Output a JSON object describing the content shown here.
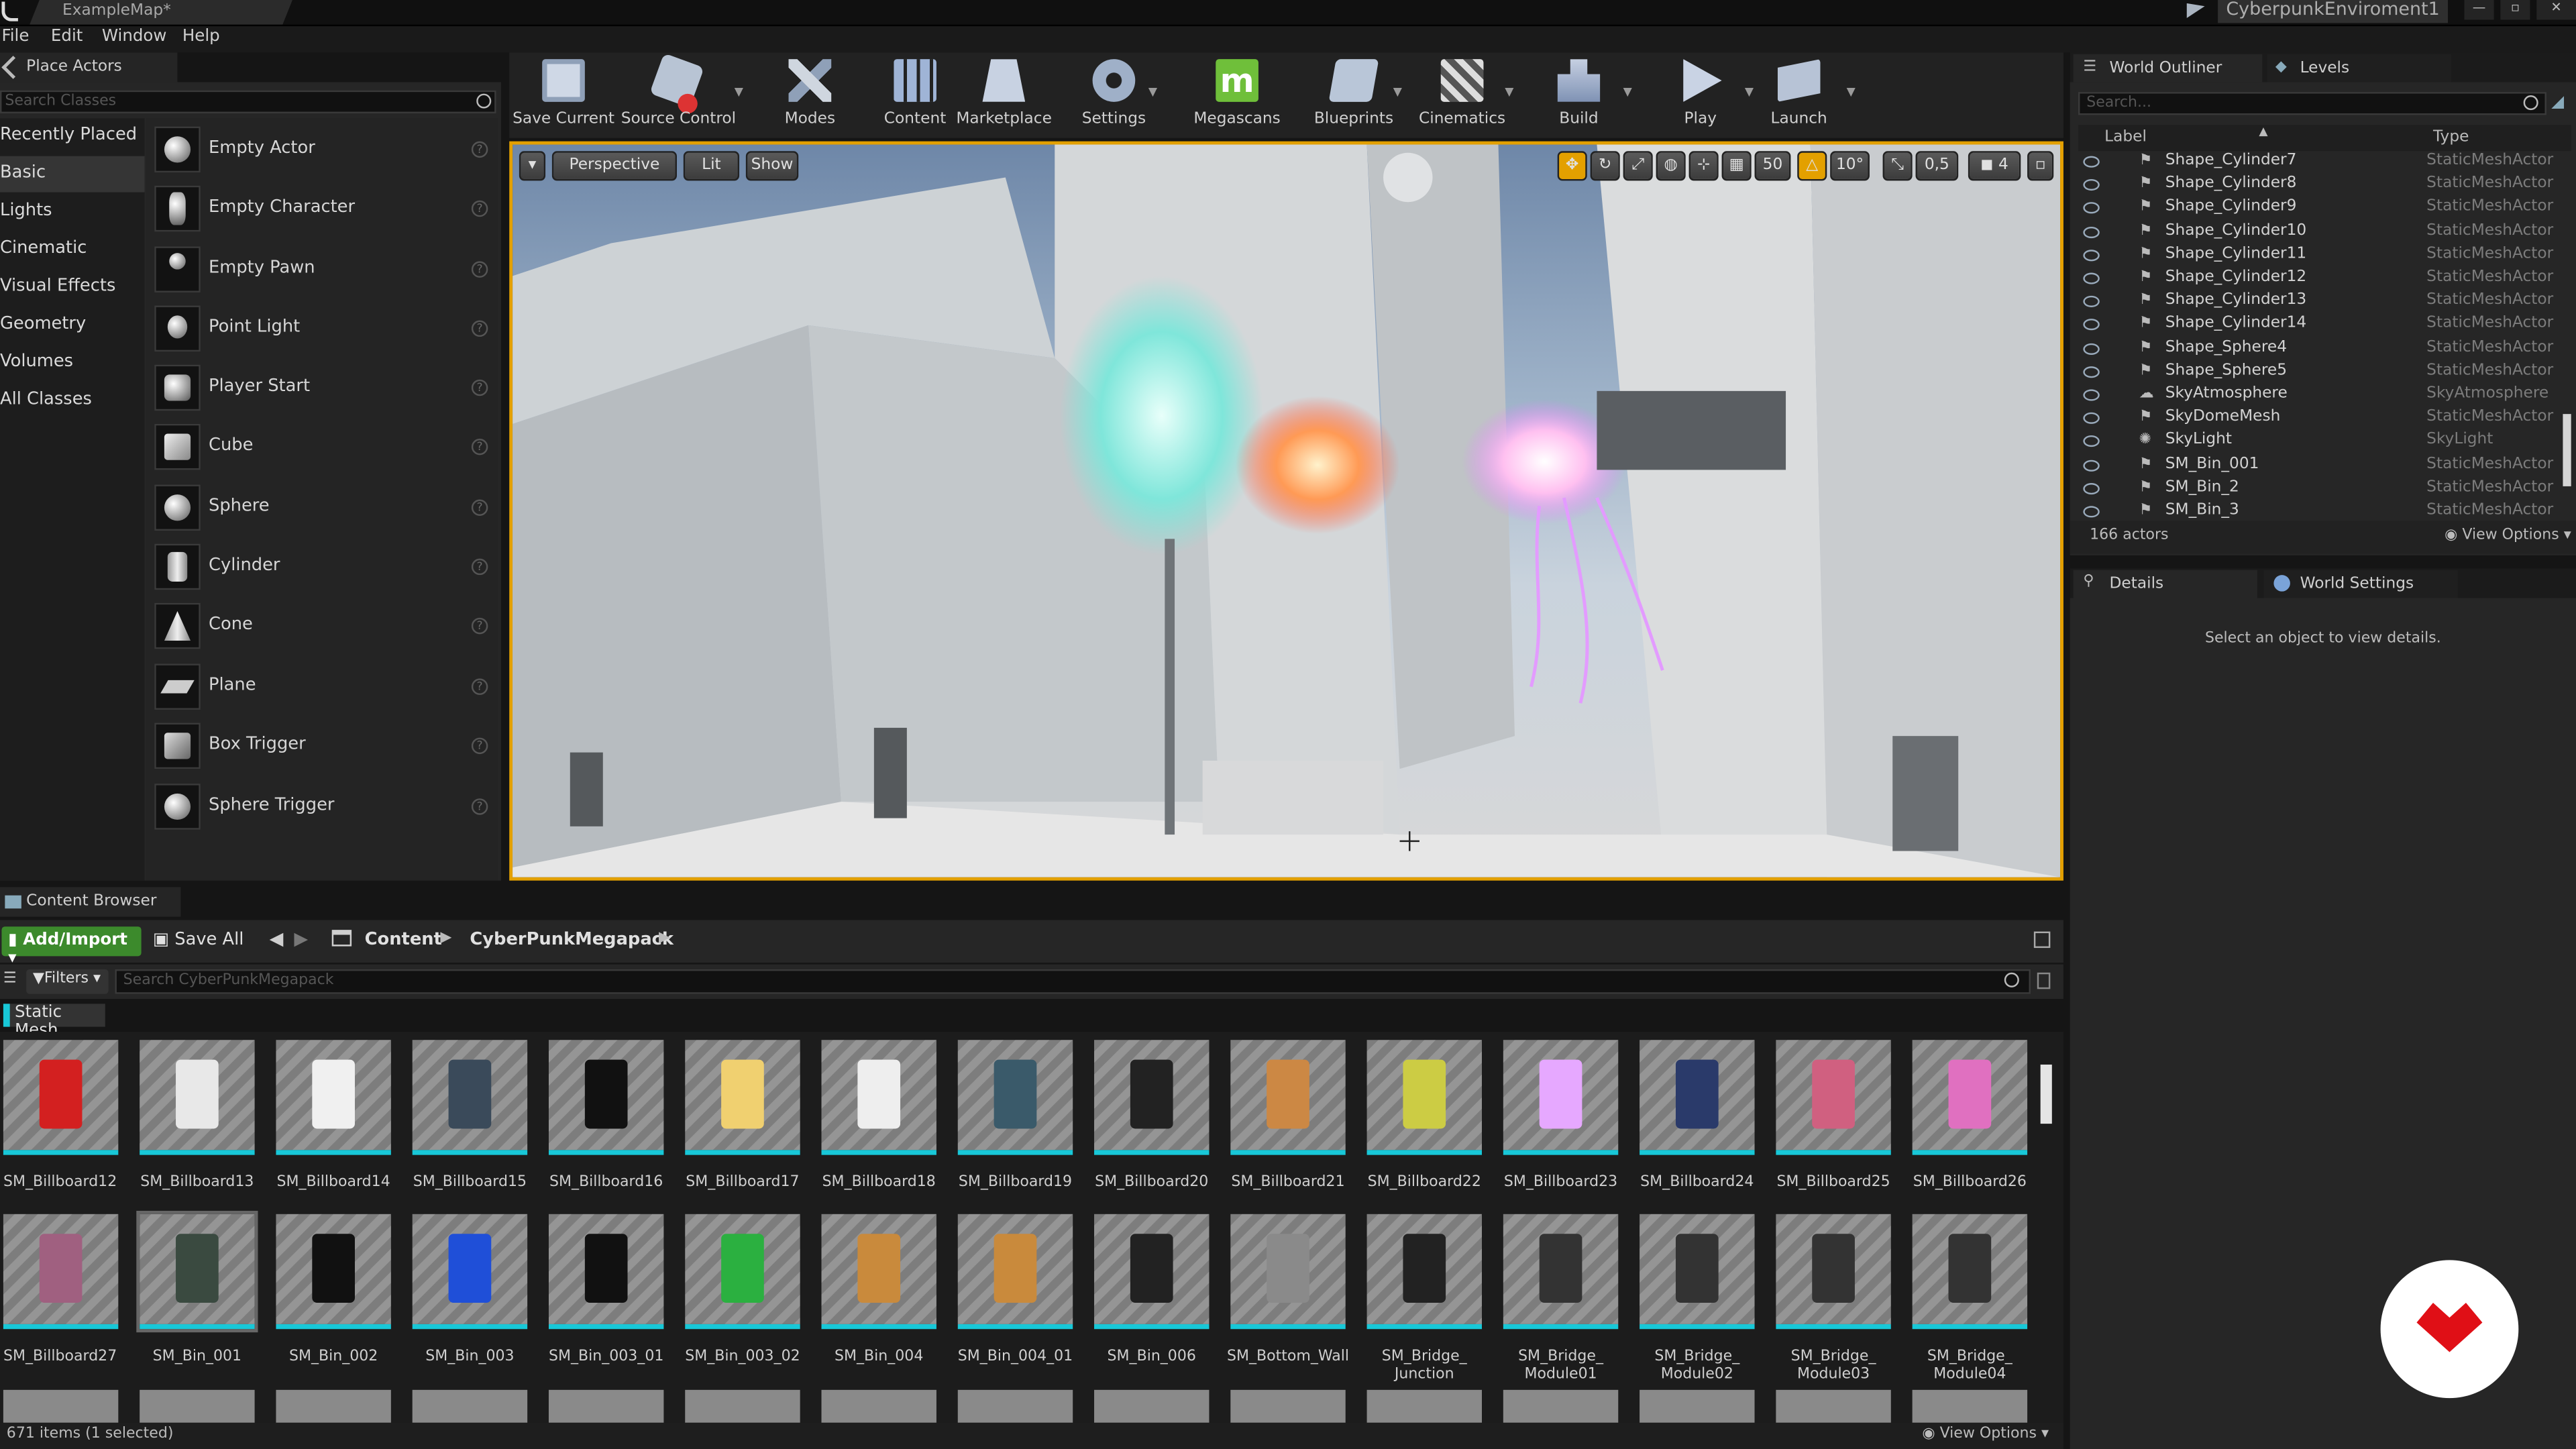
{
  "title_bar": {
    "map_tab": "ExampleMap*",
    "project_name": "CyberpunkEnviroment1"
  },
  "menu": [
    "File",
    "Edit",
    "Window",
    "Help"
  ],
  "place_actors": {
    "tab": "Place Actors",
    "search_placeholder": "Search Classes",
    "categories": [
      "Recently Placed",
      "Basic",
      "Lights",
      "Cinematic",
      "Visual Effects",
      "Geometry",
      "Volumes",
      "All Classes"
    ],
    "items": [
      "Empty Actor",
      "Empty Character",
      "Empty Pawn",
      "Point Light",
      "Player Start",
      "Cube",
      "Sphere",
      "Cylinder",
      "Cone",
      "Plane",
      "Box Trigger",
      "Sphere Trigger"
    ]
  },
  "toolbar": [
    "Save Current",
    "Source Control",
    "Modes",
    "Content",
    "Marketplace",
    "Settings",
    "Megascans",
    "Blueprints",
    "Cinematics",
    "Build",
    "Play",
    "Launch"
  ],
  "viewport": {
    "perspective": "Perspective",
    "lit": "Lit",
    "show": "Show",
    "grid": "50",
    "angle": "10°",
    "scale": "0,5",
    "speed": "4"
  },
  "outliner": {
    "tabs": [
      "World Outliner",
      "Levels"
    ],
    "search_placeholder": "Search...",
    "col_label": "Label",
    "col_type": "Type",
    "rows": [
      {
        "name": "Shape_Cylinder7",
        "type": "StaticMeshActor"
      },
      {
        "name": "Shape_Cylinder8",
        "type": "StaticMeshActor"
      },
      {
        "name": "Shape_Cylinder9",
        "type": "StaticMeshActor"
      },
      {
        "name": "Shape_Cylinder10",
        "type": "StaticMeshActor"
      },
      {
        "name": "Shape_Cylinder11",
        "type": "StaticMeshActor"
      },
      {
        "name": "Shape_Cylinder12",
        "type": "StaticMeshActor"
      },
      {
        "name": "Shape_Cylinder13",
        "type": "StaticMeshActor"
      },
      {
        "name": "Shape_Cylinder14",
        "type": "StaticMeshActor"
      },
      {
        "name": "Shape_Sphere4",
        "type": "StaticMeshActor"
      },
      {
        "name": "Shape_Sphere5",
        "type": "StaticMeshActor"
      },
      {
        "name": "SkyAtmosphere",
        "type": "SkyAtmosphere"
      },
      {
        "name": "SkyDomeMesh",
        "type": "StaticMeshActor"
      },
      {
        "name": "SkyLight",
        "type": "SkyLight"
      },
      {
        "name": "SM_Bin_001",
        "type": "StaticMeshActor"
      },
      {
        "name": "SM_Bin_2",
        "type": "StaticMeshActor"
      },
      {
        "name": "SM_Bin_3",
        "type": "StaticMeshActor"
      }
    ],
    "actor_count": "166 actors",
    "view_options": "View Options"
  },
  "details": {
    "tabs": [
      "Details",
      "World Settings"
    ],
    "empty_message": "Select an object to view details."
  },
  "content_browser": {
    "tab": "Content Browser",
    "add_import": "Add/Import",
    "save_all": "Save All",
    "path": [
      "Content",
      "CyberPunkMegapack"
    ],
    "filters": "Filters",
    "search_placeholder": "Search CyberPunkMegapack",
    "filter_chip": "Static Mesh",
    "row1": [
      "SM_Billboard12",
      "SM_Billboard13",
      "SM_Billboard14",
      "SM_Billboard15",
      "SM_Billboard16",
      "SM_Billboard17",
      "SM_Billboard18",
      "SM_Billboard19",
      "SM_Billboard20",
      "SM_Billboard21",
      "SM_Billboard22",
      "SM_Billboard23",
      "SM_Billboard24",
      "SM_Billboard25",
      "SM_Billboard26"
    ],
    "row2": [
      "SM_Billboard27",
      "SM_Bin_001",
      "SM_Bin_002",
      "SM_Bin_003",
      "SM_Bin_003_01",
      "SM_Bin_003_02",
      "SM_Bin_004",
      "SM_Bin_004_01",
      "SM_Bin_006",
      "SM_Bottom_Wall",
      "SM_Bridge_ Junction",
      "SM_Bridge_ Module01",
      "SM_Bridge_ Module02",
      "SM_Bridge_ Module03",
      "SM_Bridge_ Module04"
    ],
    "status": "671 items (1 selected)",
    "view_options": "View Options"
  },
  "colors": {
    "accent": "#e3a000",
    "asset_stripe": "#18c8d8",
    "add_import": "#3c8a2c"
  }
}
